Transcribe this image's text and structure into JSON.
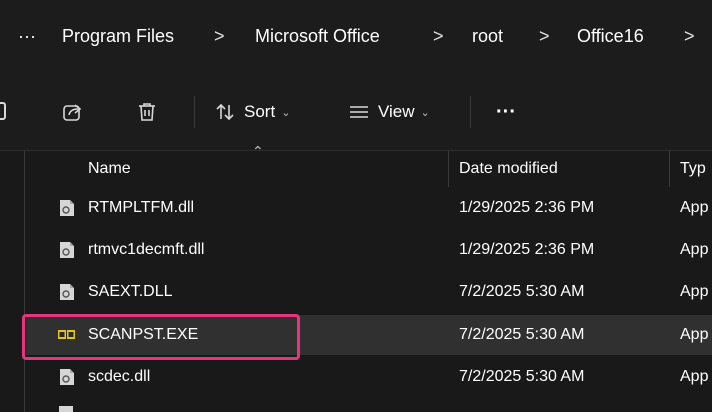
{
  "breadcrumb": {
    "more_glyph": "···",
    "separator": ">",
    "items": [
      "Program Files",
      "Microsoft Office",
      "root",
      "Office16"
    ]
  },
  "toolbar": {
    "sort_label": "Sort",
    "view_label": "View",
    "more_glyph": "···",
    "icons": [
      "share-icon",
      "delete-icon",
      "sort-icon",
      "view-icon"
    ]
  },
  "columns": {
    "name": "Name",
    "date_modified": "Date modified",
    "type": "Typ"
  },
  "files": [
    {
      "name": "RTMPLTFM.dll",
      "date": "1/29/2025 2:36 PM",
      "type": "App",
      "icon": "dll-file-icon"
    },
    {
      "name": "rtmvc1decmft.dll",
      "date": "1/29/2025 2:36 PM",
      "type": "App",
      "icon": "dll-file-icon"
    },
    {
      "name": "SAEXT.DLL",
      "date": "7/2/2025 5:30 AM",
      "type": "App",
      "icon": "dll-file-icon"
    },
    {
      "name": "SCANPST.EXE",
      "date": "7/2/2025 5:30 AM",
      "type": "App",
      "icon": "exe-file-icon",
      "selected": true
    },
    {
      "name": "scdec.dll",
      "date": "7/2/2025 5:30 AM",
      "type": "App",
      "icon": "dll-file-icon"
    }
  ],
  "colors": {
    "background": "#1c1c1c",
    "selected_row": "#303030",
    "highlight": "#e8337f"
  }
}
